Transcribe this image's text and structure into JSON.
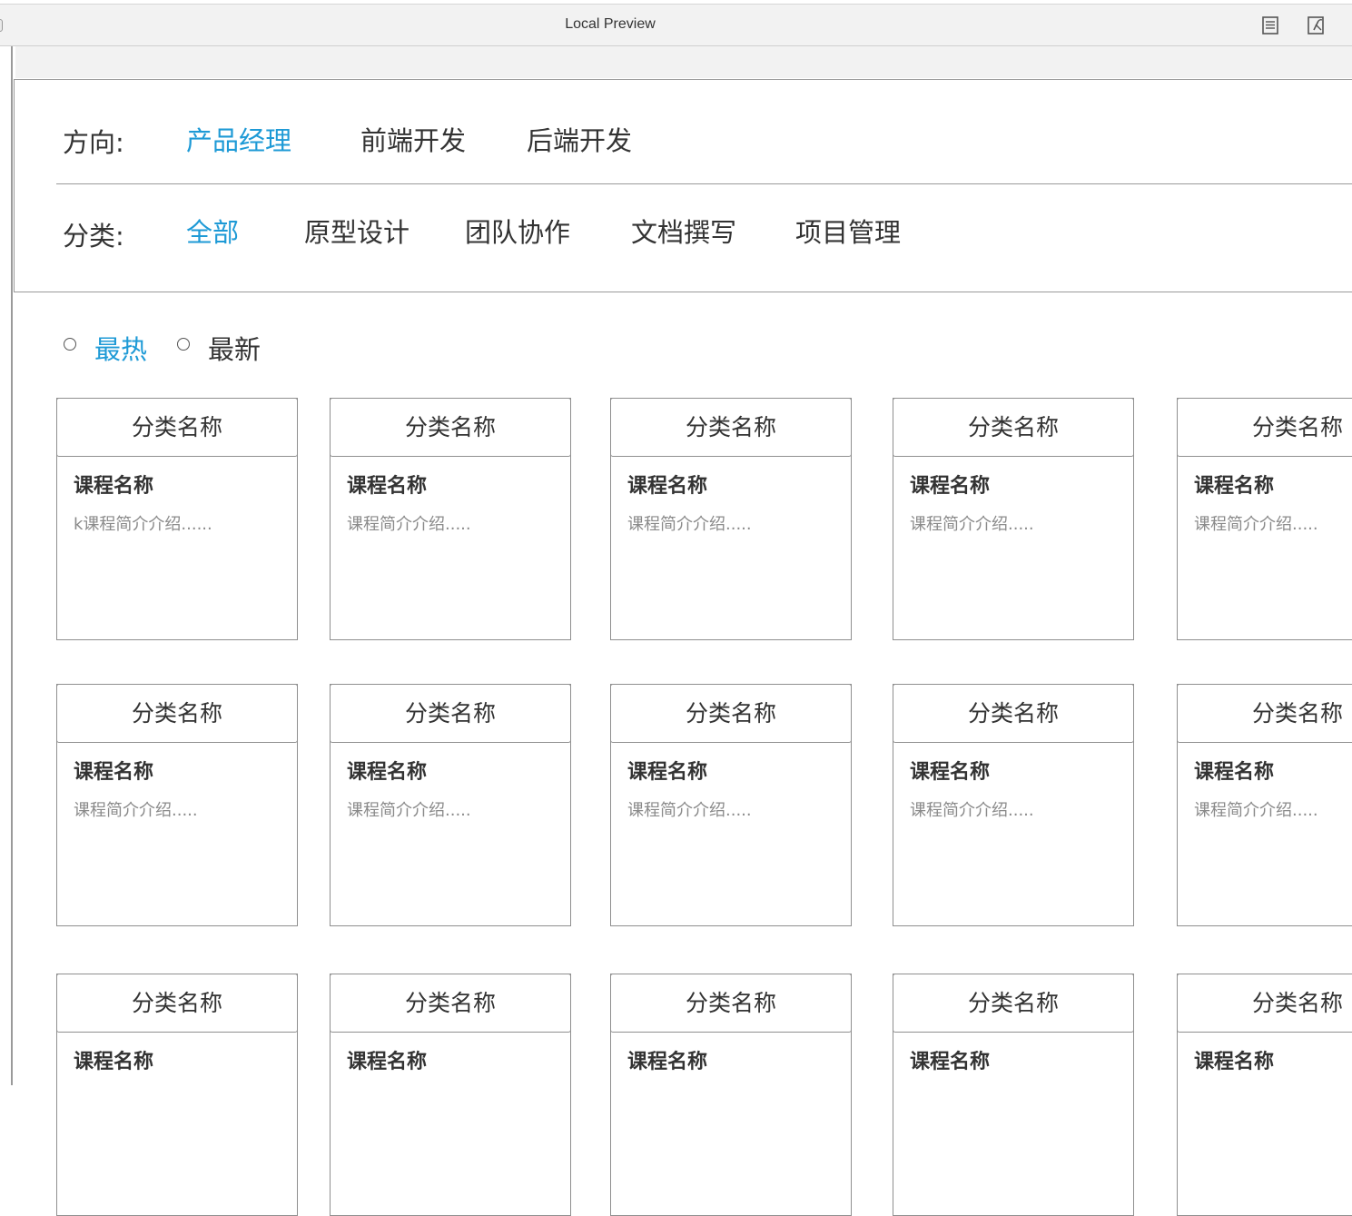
{
  "window": {
    "title": "Local Preview",
    "icons": [
      "document-icon",
      "variable-icon"
    ]
  },
  "filters": {
    "direction": {
      "label": "方向:",
      "options": [
        "产品经理",
        "前端开发",
        "后端开发"
      ],
      "active_index": 0
    },
    "category": {
      "label": "分类:",
      "options": [
        "全部",
        "原型设计",
        "团队协作",
        "文档撰写",
        "项目管理"
      ],
      "active_index": 0
    }
  },
  "sort": {
    "options": [
      "最热",
      "最新"
    ],
    "active_index": 0
  },
  "cards": [
    {
      "category": "分类名称",
      "name": "课程名称",
      "desc": "k课程简介介绍......"
    },
    {
      "category": "分类名称",
      "name": "课程名称",
      "desc": "课程简介介绍....."
    },
    {
      "category": "分类名称",
      "name": "课程名称",
      "desc": "课程简介介绍....."
    },
    {
      "category": "分类名称",
      "name": "课程名称",
      "desc": "课程简介介绍....."
    },
    {
      "category": "分类名称",
      "name": "课程名称",
      "desc": "课程简介介绍....."
    },
    {
      "category": "分类名称",
      "name": "课程名称",
      "desc": "课程简介介绍....."
    },
    {
      "category": "分类名称",
      "name": "课程名称",
      "desc": "课程简介介绍....."
    },
    {
      "category": "分类名称",
      "name": "课程名称",
      "desc": "课程简介介绍....."
    },
    {
      "category": "分类名称",
      "name": "课程名称",
      "desc": "课程简介介绍....."
    },
    {
      "category": "分类名称",
      "name": "课程名称",
      "desc": "课程简介介绍....."
    },
    {
      "category": "分类名称",
      "name": "课程名称",
      "desc": ""
    },
    {
      "category": "分类名称",
      "name": "课程名称",
      "desc": ""
    },
    {
      "category": "分类名称",
      "name": "课程名称",
      "desc": ""
    },
    {
      "category": "分类名称",
      "name": "课程名称",
      "desc": ""
    },
    {
      "category": "分类名称",
      "name": "课程名称",
      "desc": ""
    }
  ],
  "colors": {
    "accent": "#1e9ad6",
    "text": "#333333",
    "muted": "#8a8a8a",
    "border": "#8f8f8f"
  }
}
